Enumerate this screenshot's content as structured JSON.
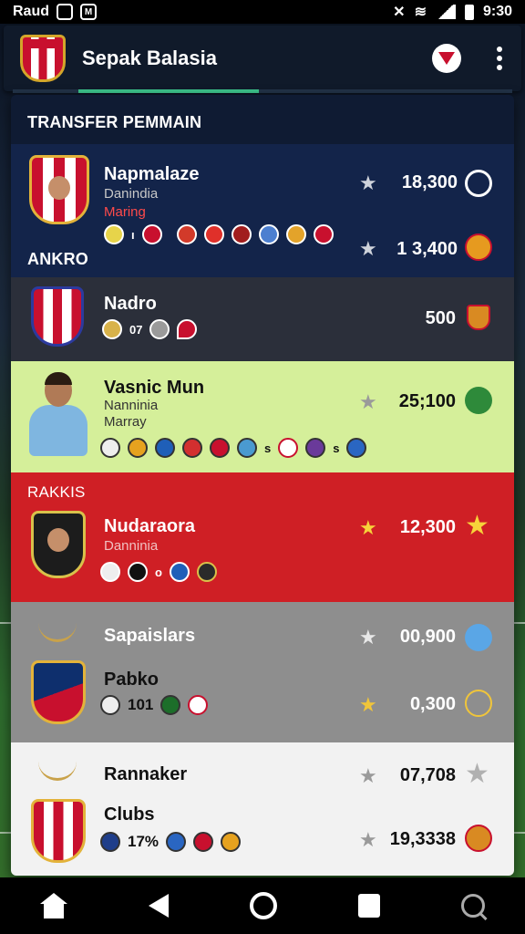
{
  "status_bar": {
    "carrier": "Raud",
    "time": "9:30"
  },
  "app_bar": {
    "title": "Sepak Balasia"
  },
  "sections": {
    "transfer_title": "TRANSFER PEMMAIN",
    "ankro_title": "ANKRO",
    "rakkis_title": "RAKKIS"
  },
  "cards": [
    {
      "name": "Napmalaze",
      "sub1": "Danindia",
      "sub2": "Maring",
      "price": "18,300",
      "price2": "1 3,400"
    },
    {
      "name": "Nadro",
      "badge_text": "07",
      "price": "500"
    },
    {
      "name": "Vasnic Mun",
      "sub1": "Nanninia",
      "sub2": "Marray",
      "price": "25;100",
      "badge_text": "s",
      "badge_text2": "s"
    },
    {
      "name": "Nudaraora",
      "sub1": "Danninia",
      "price": "12,300",
      "badge_text": "o"
    },
    {
      "name": "Sapaislars",
      "price": "00,900"
    },
    {
      "name": "Pabko",
      "badge_text": "101",
      "price": "0,300"
    },
    {
      "name": "Rannaker",
      "price": "07,708"
    },
    {
      "name": "Clubs",
      "badge_text": "17%",
      "price": "19,3338"
    }
  ],
  "colors": {
    "navy": "#0f1b33",
    "dark": "#2b2f3a",
    "lime": "#d5ef9a",
    "red": "#cf1f25",
    "grey": "#8e8e8e",
    "white": "#f2f2f2"
  }
}
